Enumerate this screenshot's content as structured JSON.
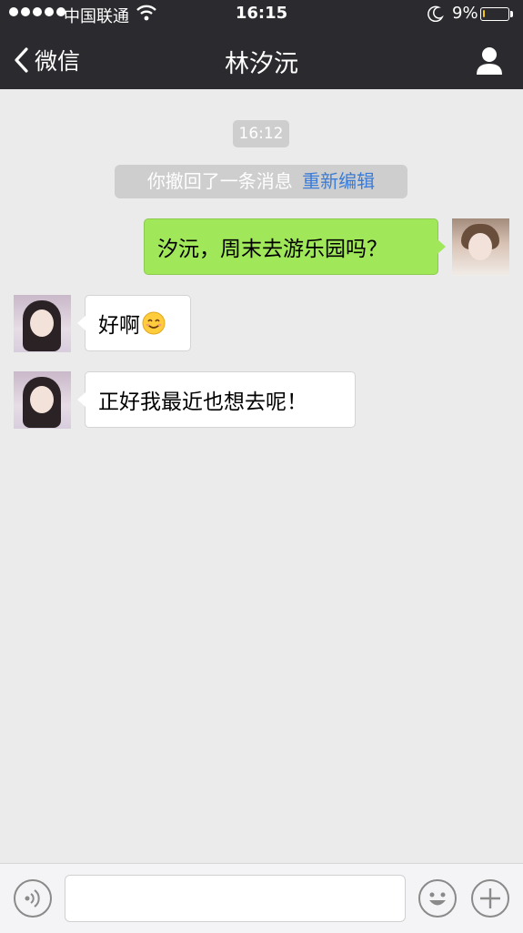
{
  "status_bar": {
    "carrier": "中国联通",
    "time": "16:15",
    "battery_percent": "9%",
    "battery_level": 0.09,
    "signal_dots": 5
  },
  "nav": {
    "back_label": "微信",
    "title": "林汐沅"
  },
  "chat": {
    "timestamp": "16:12",
    "recall_notice": "你撤回了一条消息",
    "recall_action": "重新编辑",
    "messages": [
      {
        "from": "me",
        "text": "汐沅，周末去游乐园吗？"
      },
      {
        "from": "them",
        "text": "好啊",
        "emoji": "smiling-face-icon"
      },
      {
        "from": "them",
        "text": "正好我最近也想去呢！"
      }
    ]
  },
  "input_bar": {
    "value": "",
    "icons": [
      "voice-icon",
      "emoji-icon",
      "plus-icon"
    ]
  },
  "colors": {
    "nav_bg": "#2b2b2f",
    "chat_bg": "#ebebeb",
    "outgoing_bubble": "#a0e75a",
    "incoming_bubble": "#ffffff",
    "link": "#3b7cd6"
  }
}
